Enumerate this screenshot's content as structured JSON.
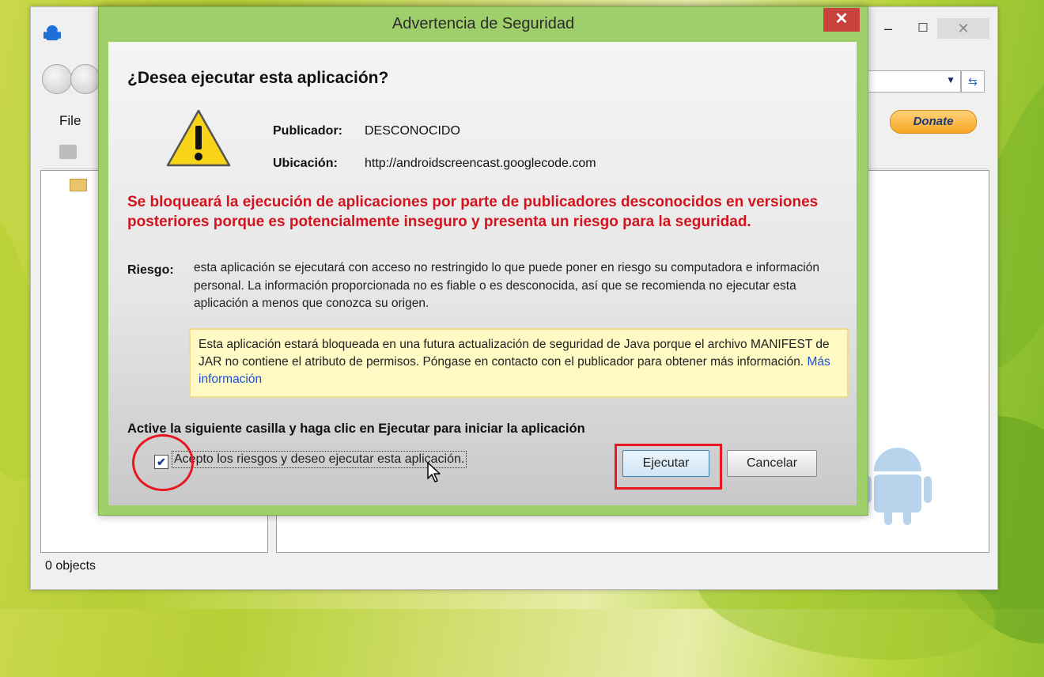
{
  "app": {
    "file_menu": "File",
    "donate_label": "Donate",
    "status": "0 objects",
    "window_controls": {
      "minimize": "–",
      "maximize": "☐",
      "close": "✕"
    }
  },
  "dialog": {
    "title": "Advertencia de Seguridad",
    "close_glyph": "✕",
    "question": "¿Desea ejecutar esta aplicación?",
    "publisher_label": "Publicador:",
    "publisher_value": "DESCONOCIDO",
    "location_label": "Ubicación:",
    "location_value": "http://androidscreencast.googlecode.com",
    "red_warning": "Se bloqueará la ejecución de aplicaciones por parte de publicadores desconocidos en versiones posteriores porque es potencialmente inseguro y presenta un riesgo para la seguridad.",
    "risk_label": "Riesgo:",
    "risk_text": "esta aplicación se ejecutará con acceso no restringido lo que puede poner en riesgo su computadora e información personal. La información proporcionada no es fiable o es desconocida, así que se recomienda no ejecutar esta aplicación a menos que conozca su origen.",
    "info_text": "Esta aplicación estará bloqueada en una futura actualización de seguridad de Java porque el archivo MANIFEST de JAR no contiene el atributo de permisos. Póngase en contacto con el publicador para obtener más información.",
    "info_link": "Más información",
    "instruction": "Active la siguiente casilla y haga clic en Ejecutar para iniciar la aplicación",
    "checkbox_label": "Acepto los riesgos y deseo ejecutar esta aplicación.",
    "checkbox_checked": true,
    "run_button": "Ejecutar",
    "cancel_button": "Cancelar"
  },
  "colors": {
    "warning_red": "#d2141f",
    "highlight_red": "#e8161f",
    "dialog_frame": "#9fcf6a",
    "link_blue": "#1a4fd6"
  }
}
